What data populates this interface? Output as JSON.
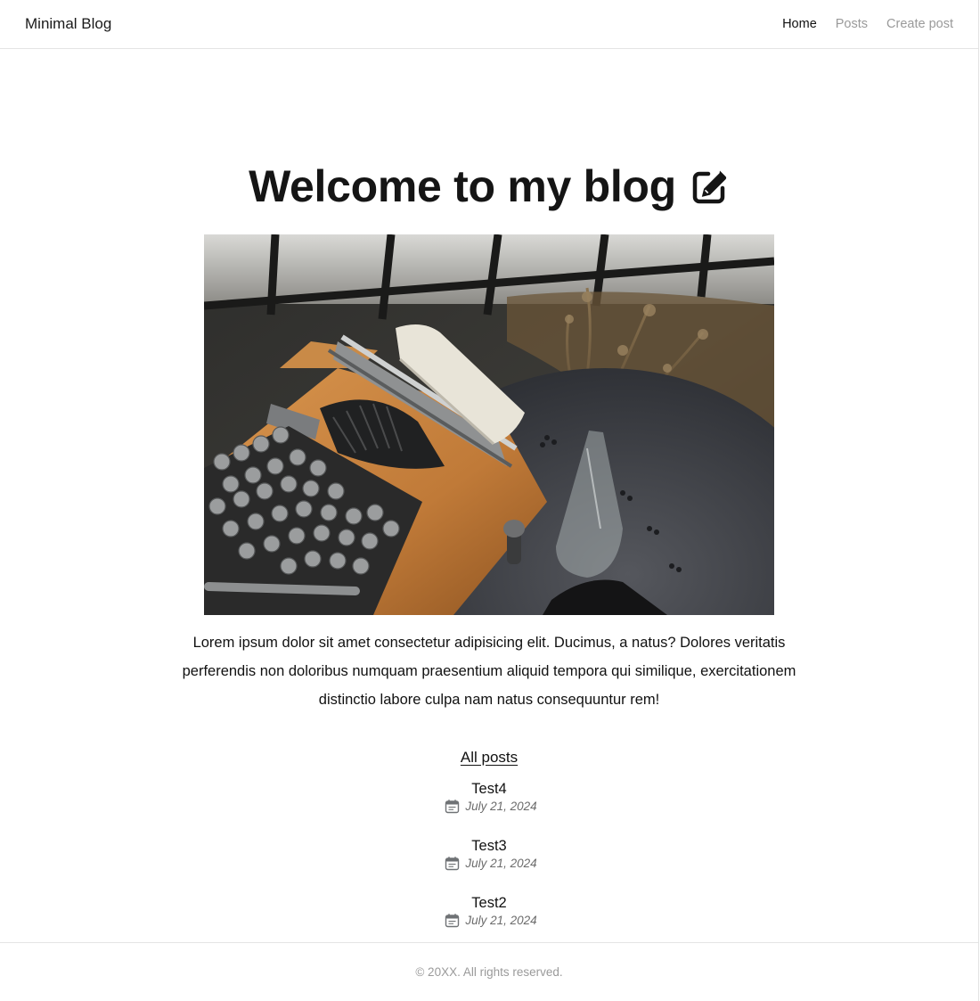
{
  "header": {
    "brand": "Minimal Blog",
    "nav": [
      {
        "label": "Home",
        "active": true
      },
      {
        "label": "Posts",
        "active": false
      },
      {
        "label": "Create post",
        "active": false
      }
    ]
  },
  "hero": {
    "title": "Welcome to my blog",
    "icon": "pencil-square-icon",
    "image": "typewriter-photo",
    "intro": "Lorem ipsum dolor sit amet consectetur adipisicing elit. Ducimus, a natus? Dolores veritatis perferendis non doloribus numquam praesentium aliquid tempora qui similique, exercitationem distinctio labore culpa nam natus consequuntur rem!"
  },
  "posts": {
    "heading": "All posts",
    "items": [
      {
        "title": "Test4",
        "date": "July 21, 2024"
      },
      {
        "title": "Test3",
        "date": "July 21, 2024"
      },
      {
        "title": "Test2",
        "date": "July 21, 2024"
      }
    ]
  },
  "footer": {
    "text": "© 20XX. All rights reserved."
  },
  "colors": {
    "text": "#111111",
    "muted": "#9a9a9a",
    "border": "#e4e4e4"
  }
}
